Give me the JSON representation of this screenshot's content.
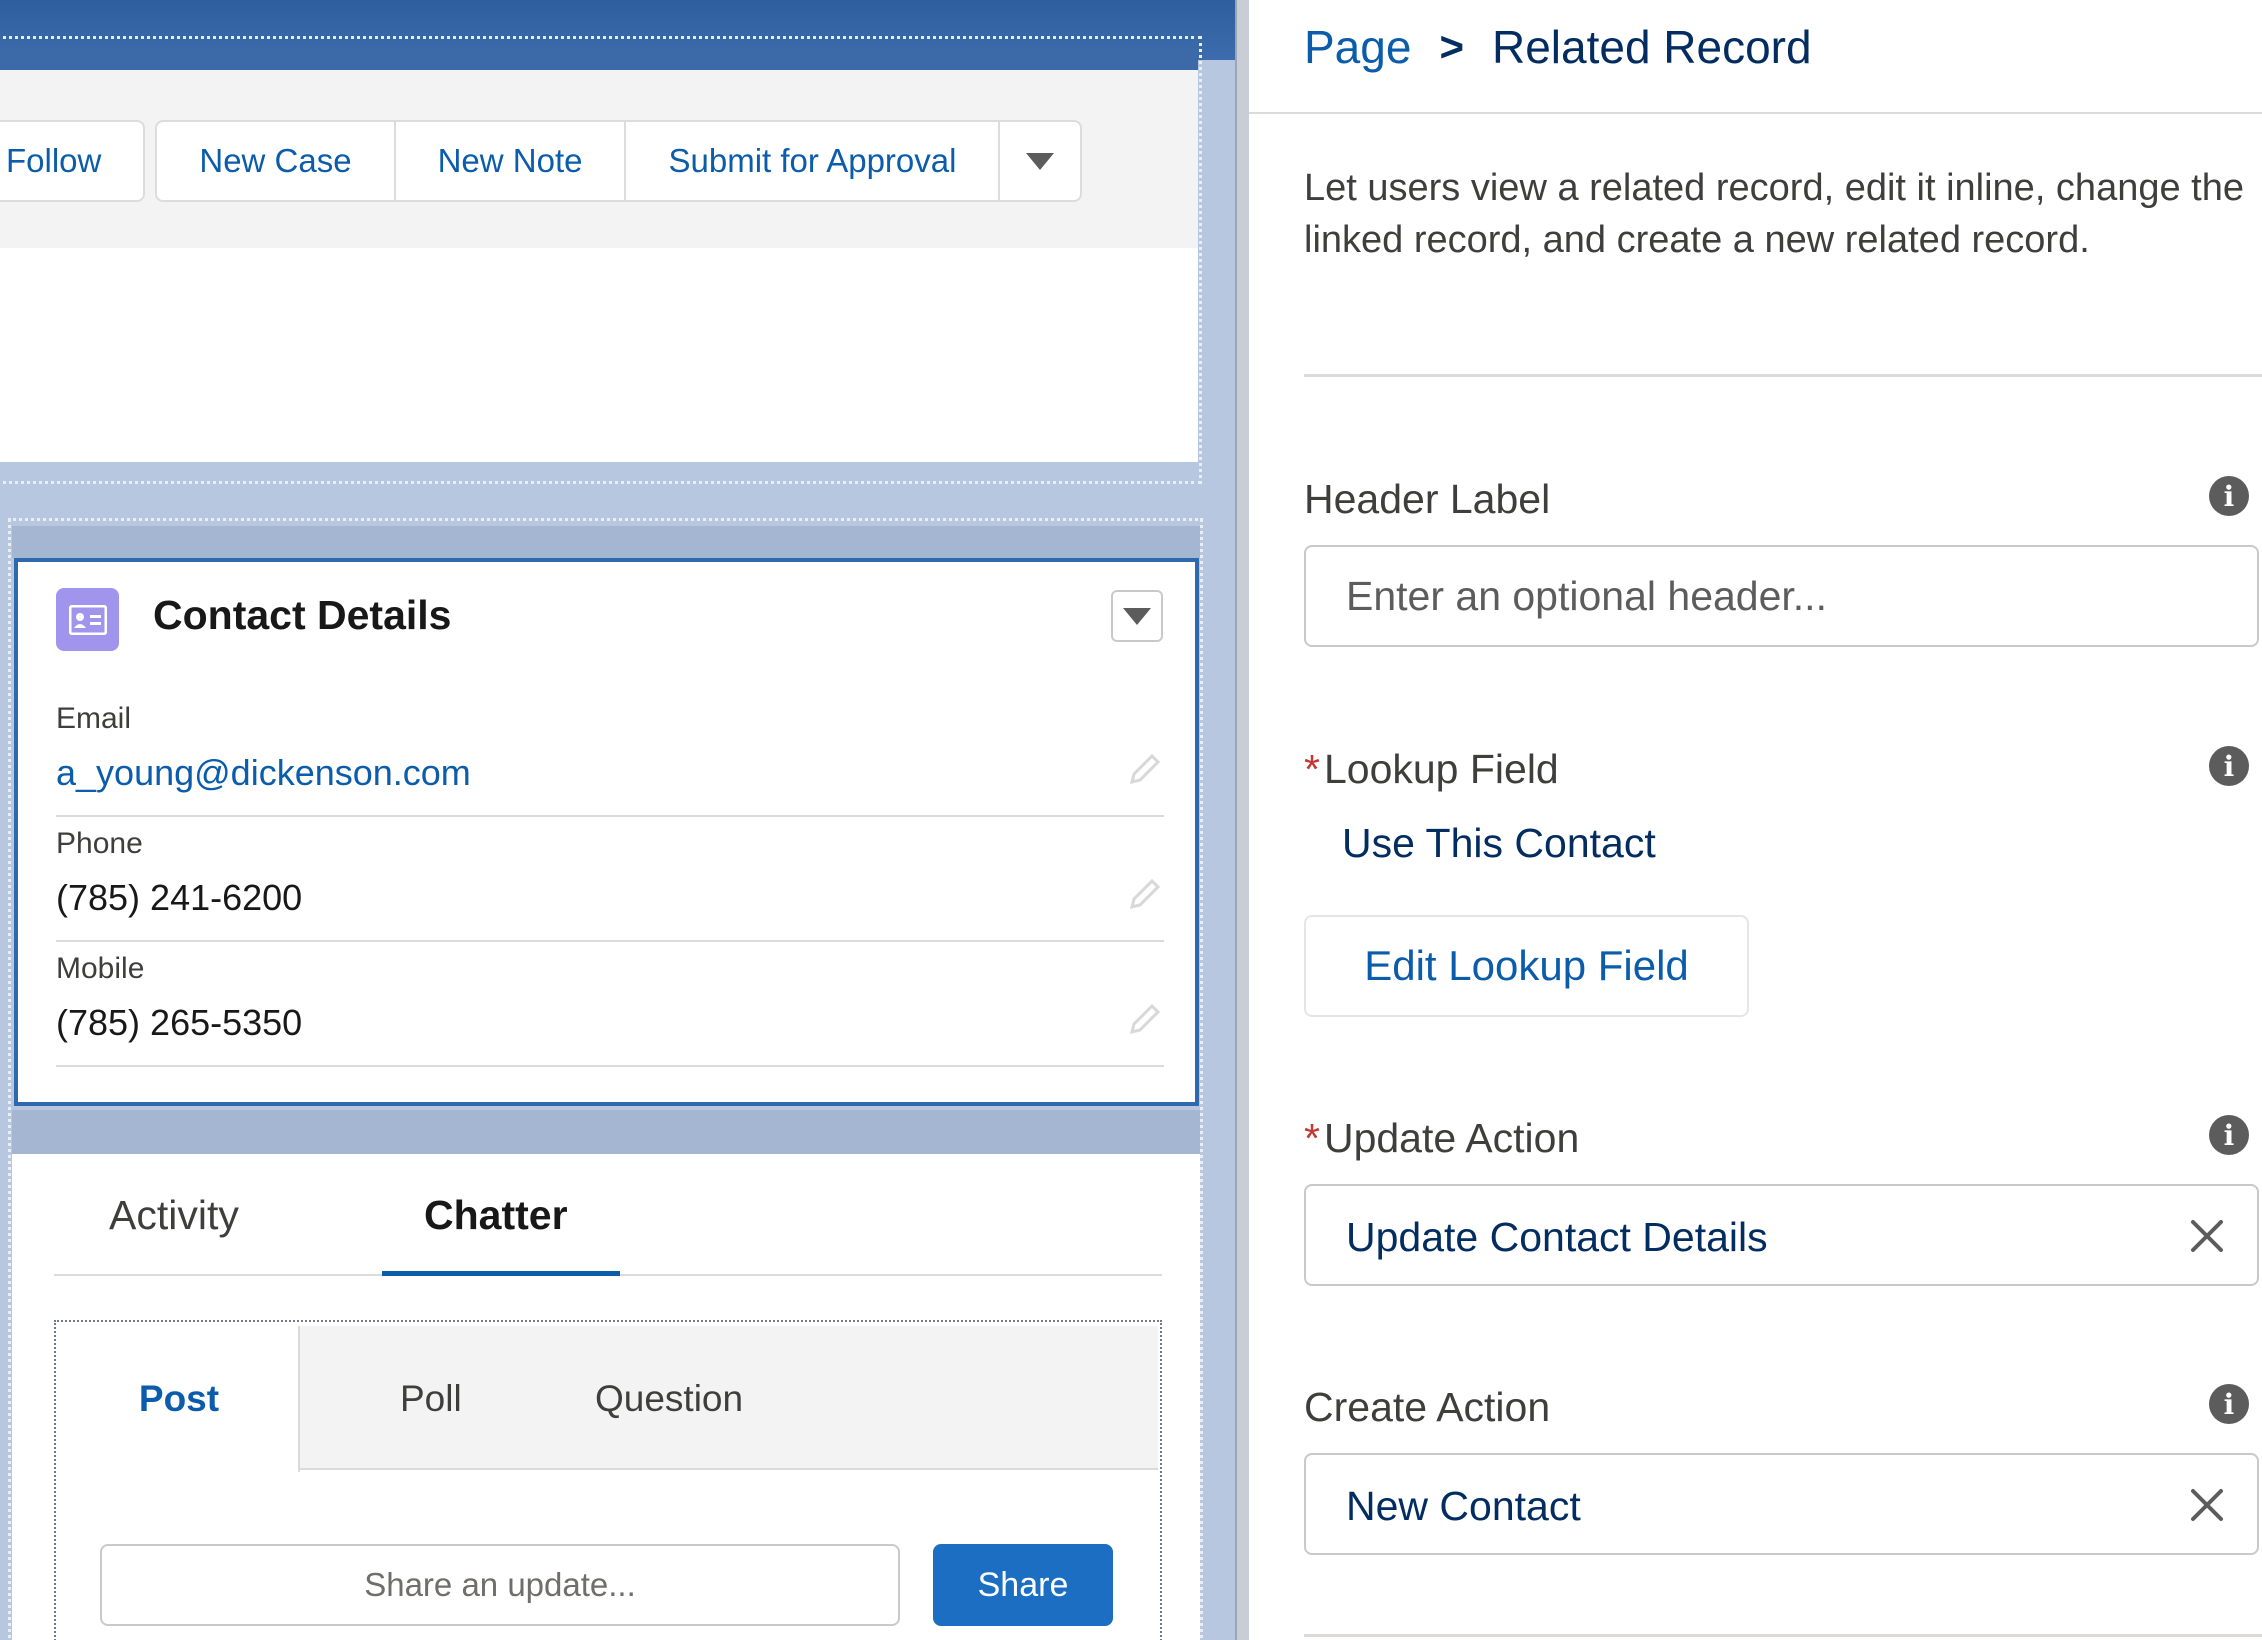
{
  "highlights": {
    "actions": [
      "Follow",
      "New Case",
      "New Note",
      "Submit for Approval"
    ],
    "more_actions_icon": "chevron-down-icon"
  },
  "contact_card": {
    "icon": "contact-card-icon",
    "title": "Contact Details",
    "fields": [
      {
        "label": "Email",
        "value": "a_young@dickenson.com"
      },
      {
        "label": "Phone",
        "value": "(785) 241-6200"
      },
      {
        "label": "Mobile",
        "value": "(785) 265-5350"
      }
    ]
  },
  "feed": {
    "tabs": [
      "Activity",
      "Chatter"
    ],
    "active_tab": "Chatter",
    "publisher_tabs": [
      "Post",
      "Poll",
      "Question"
    ],
    "active_publisher_tab": "Post",
    "share_placeholder": "Share an update...",
    "share_label": "Share"
  },
  "panel": {
    "breadcrumb": {
      "parent": "Page",
      "separator": ">",
      "current": "Related Record"
    },
    "description": "Let users view a related record, edit it inline, change the linked record, and create a new related record.",
    "header_label": {
      "label": "Header Label",
      "placeholder": "Enter an optional header...",
      "value": ""
    },
    "lookup_field": {
      "label": "Lookup Field",
      "required_marker": "*",
      "value": "Use This Contact",
      "button": "Edit Lookup Field"
    },
    "update_action": {
      "label": "Update Action",
      "required_marker": "*",
      "value": "Update Contact Details"
    },
    "create_action": {
      "label": "Create Action",
      "value": "New Contact"
    }
  },
  "colors": {
    "link_blue": "#0b5cab",
    "brand_blue": "#1b6ec2",
    "canvas_blue": "#b6c7df",
    "required_red": "#c23934",
    "contact_icon_purple": "#a094ed"
  }
}
